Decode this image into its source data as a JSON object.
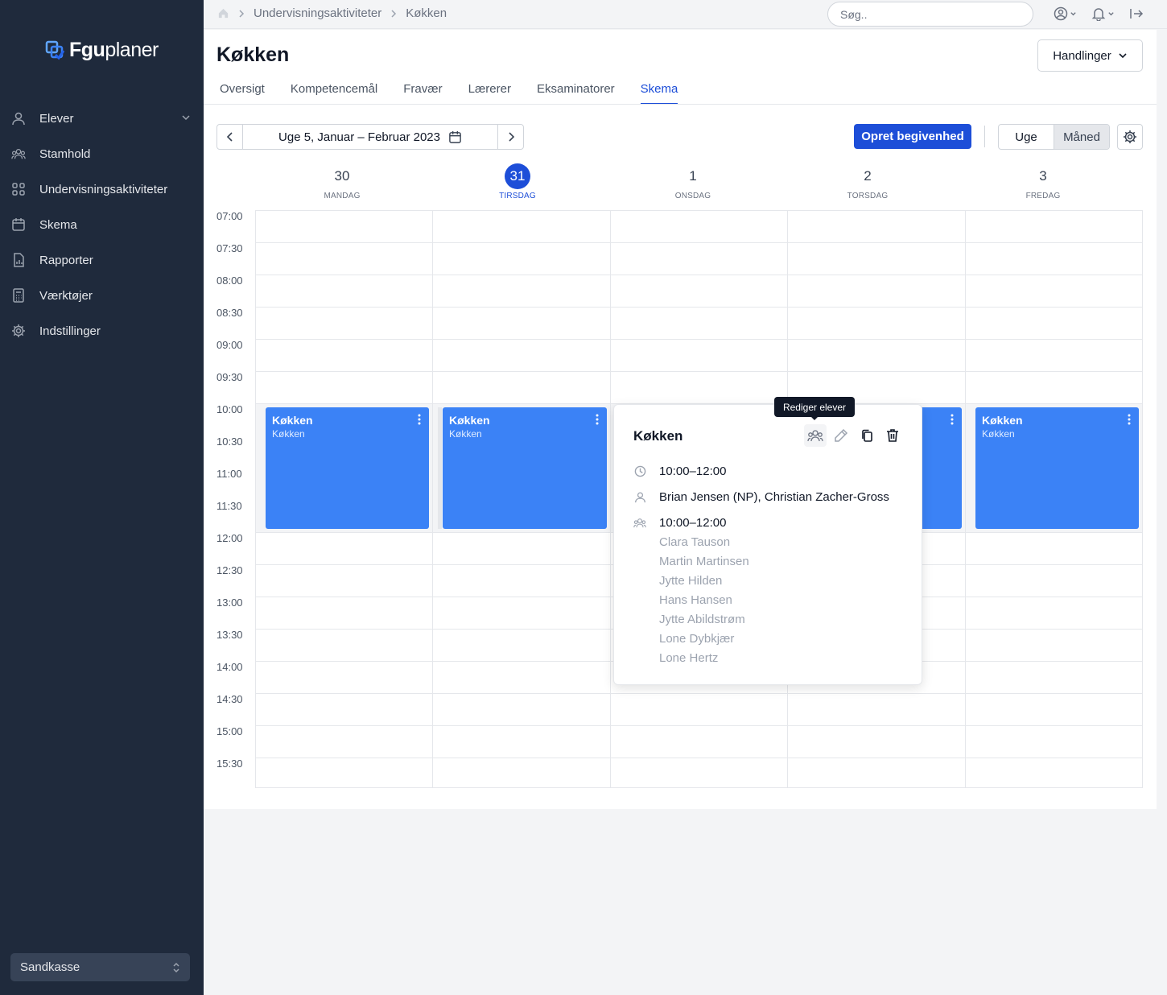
{
  "sidebar": {
    "logo_bold": "Fgu",
    "logo_rest": "planer",
    "items": [
      {
        "label": "Elever",
        "icon": "user-icon"
      },
      {
        "label": "Stamhold",
        "icon": "users-icon"
      },
      {
        "label": "Undervisningsaktiviteter",
        "icon": "grid-icon"
      },
      {
        "label": "Skema",
        "icon": "calendar-icon"
      },
      {
        "label": "Rapporter",
        "icon": "report-icon"
      },
      {
        "label": "Værktøjer",
        "icon": "calculator-icon"
      },
      {
        "label": "Indstillinger",
        "icon": "gear-icon"
      }
    ],
    "workspace": "Sandkasse"
  },
  "topbar": {
    "breadcrumb": [
      "Undervisningsaktiviteter",
      "Køkken"
    ],
    "search_placeholder": "Søg.."
  },
  "page": {
    "title": "Køkken",
    "actions_label": "Handlinger",
    "tabs": [
      "Oversigt",
      "Kompetencemål",
      "Fravær",
      "Lærerer",
      "Eksaminatorer",
      "Skema"
    ],
    "active_tab": "Skema"
  },
  "toolbar": {
    "range_label": "Uge 5, Januar – Februar 2023",
    "create_label": "Opret begivenhed",
    "view_week": "Uge",
    "view_month": "Måned",
    "active_view": "Måned"
  },
  "calendar": {
    "days": [
      {
        "num": "30",
        "name": "MANDAG"
      },
      {
        "num": "31",
        "name": "TIRSDAG",
        "today": true
      },
      {
        "num": "1",
        "name": "ONSDAG"
      },
      {
        "num": "2",
        "name": "TORSDAG"
      },
      {
        "num": "3",
        "name": "FREDAG"
      }
    ],
    "times": [
      "07:00",
      "07:30",
      "08:00",
      "08:30",
      "09:00",
      "09:30",
      "10:00",
      "10:30",
      "11:00",
      "11:30",
      "12:00",
      "12:30",
      "13:00",
      "13:30",
      "14:00",
      "14:30",
      "15:00",
      "15:30"
    ],
    "events": [
      {
        "title": "Køkken",
        "subtitle": "Køkken"
      },
      {
        "title": "Køkken",
        "subtitle": "Køkken"
      },
      {
        "title": "Køkken",
        "subtitle": "Køkken"
      },
      {
        "title": "Køkken",
        "subtitle": "Køkken"
      }
    ]
  },
  "popover": {
    "title": "Køkken",
    "time": "10:00–12:00",
    "teachers": "Brian Jensen (NP), Christian Zacher-Gross",
    "group_time": "10:00–12:00",
    "students": [
      "Clara Tauson",
      "Martin Martinsen",
      "Jytte Hilden",
      "Hans Hansen",
      "Jytte Abildstrøm",
      "Lone Dybkjær",
      "Lone Hertz"
    ],
    "tooltip": "Rediger elever"
  },
  "colors": {
    "sidebar_bg": "#1f2a3c",
    "primary": "#1d4ed8",
    "event": "#3b82f6"
  }
}
